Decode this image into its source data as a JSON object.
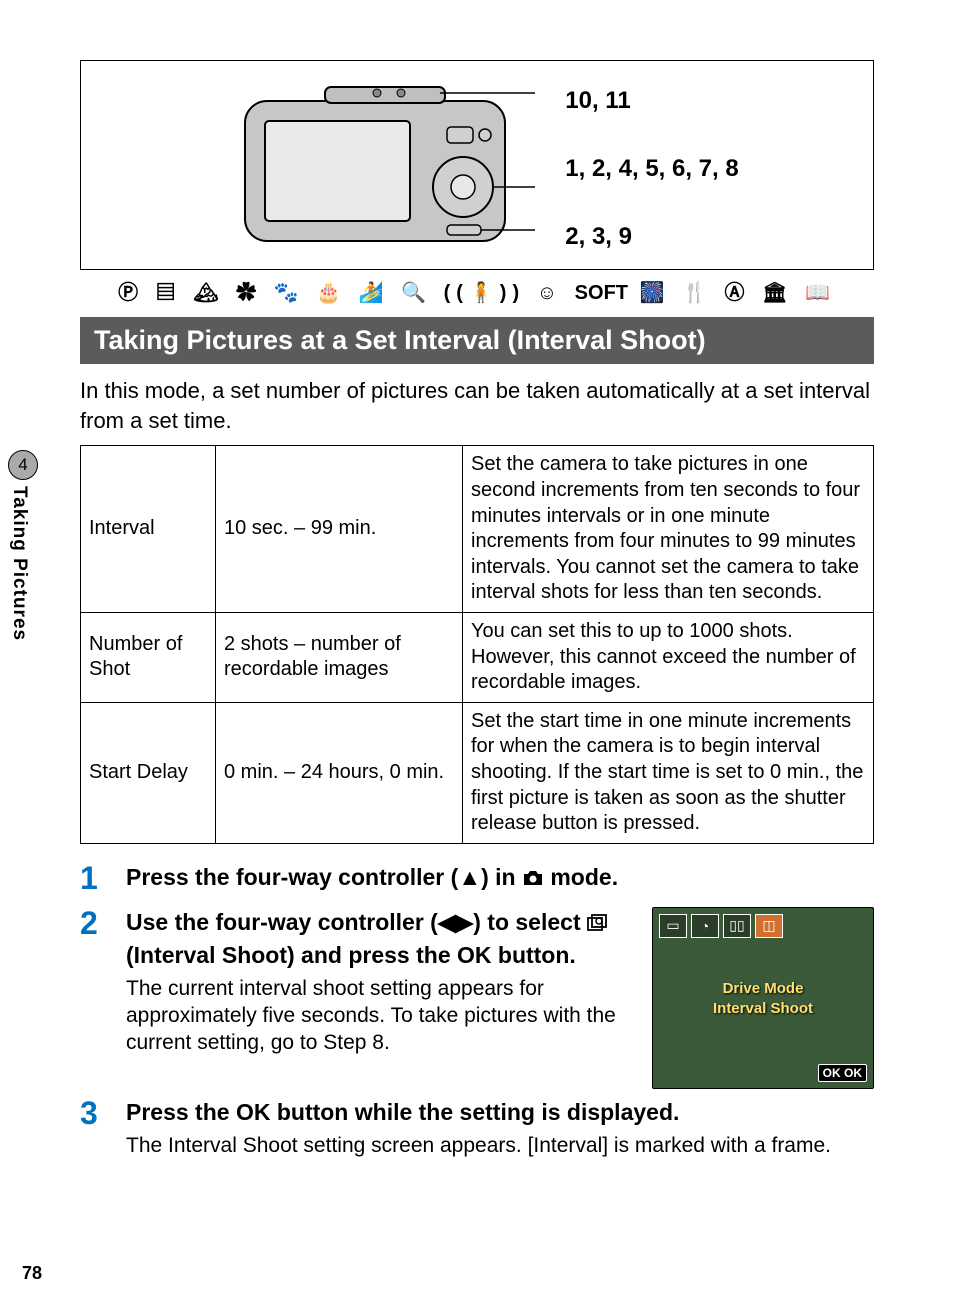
{
  "side_tab": {
    "number": "4",
    "label": "Taking Pictures"
  },
  "page_number": "78",
  "callouts": {
    "a": "10, 11",
    "b": "1, 2, 4, 5, 6, 7, 8",
    "c": "2, 3, 9"
  },
  "icon_row_soft": "SOFT",
  "section_title": "Taking Pictures at a Set Interval (Interval Shoot)",
  "intro": "In this mode, a set number of pictures can be taken automatically at a set interval from a set time.",
  "table": {
    "rows": [
      {
        "name": "Interval",
        "range": "10 sec. – 99 min.",
        "desc": "Set the camera to take pictures in one second increments from ten seconds to four minutes intervals or in one minute increments from four minutes to 99 minutes intervals. You cannot set the camera to take interval shots for less than ten seconds."
      },
      {
        "name": "Number of Shot",
        "range": "2 shots – number of recordable images",
        "desc": "You can set this to up to 1000 shots. However, this cannot exceed the number of recordable images."
      },
      {
        "name": "Start Delay",
        "range": "0 min. – 24 hours, 0 min.",
        "desc": "Set the start time in one minute increments for when the camera is to begin interval shooting. If the start time is set to 0 min., the first picture is taken as soon as the shutter release button is pressed."
      }
    ]
  },
  "steps": {
    "s1": {
      "num": "1",
      "heading_a": "Press the four-way controller (",
      "heading_b": ") in ",
      "heading_c": " mode."
    },
    "s2": {
      "num": "2",
      "heading_a": "Use the four-way controller (",
      "heading_b": ") to select ",
      "heading_c": " (Interval Shoot) and press the ",
      "heading_d": " button.",
      "ok": "OK",
      "desc": "The current interval shoot setting appears for approximately five seconds. To take pictures with the current setting, go to Step 8."
    },
    "s3": {
      "num": "3",
      "heading_a": "Press the ",
      "heading_b": " button while the setting is displayed.",
      "ok": "OK",
      "desc": "The Interval Shoot setting screen appears. [Interval] is marked with a frame."
    }
  },
  "thumb": {
    "label1": "Drive Mode",
    "label2": "Interval Shoot",
    "ok": "OK OK"
  }
}
